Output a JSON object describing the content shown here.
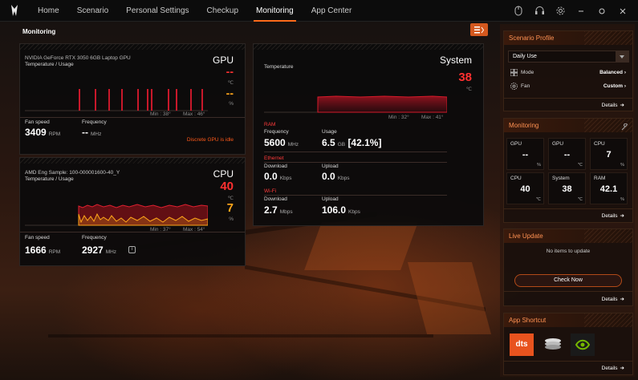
{
  "nav": {
    "tabs": [
      "Home",
      "Scenario",
      "Personal Settings",
      "Checkup",
      "Monitoring",
      "App Center"
    ],
    "active_index": 4
  },
  "icons": {
    "logo": "predator-logo-icon",
    "mouse": "mouse-icon",
    "headset": "headset-icon",
    "settings": "gear-icon",
    "minimize": "minimize-icon",
    "maximize": "restore-icon",
    "close": "close-icon"
  },
  "page": {
    "title": "Monitoring"
  },
  "gpu": {
    "name": "NVIDIA GeForce RTX 3050 6GB Laptop GPU",
    "subtitle": "Temperature / Usage",
    "title": "GPU",
    "temp_value": "--",
    "temp_unit": "℃",
    "usage_value": "--",
    "usage_unit": "%",
    "min": "Min : 38°",
    "max": "Max : 46°",
    "fan_label": "Fan speed",
    "fan_value": "3409",
    "fan_unit": "RPM",
    "freq_label": "Frequency",
    "freq_value": "--",
    "freq_unit": "MHz",
    "status": "Discrete GPU is idle"
  },
  "cpu": {
    "name": "AMD Eng Sample: 100-000001600-40_Y",
    "subtitle": "Temperature / Usage",
    "title": "CPU",
    "temp_value": "40",
    "temp_unit": "℃",
    "usage_value": "7",
    "usage_unit": "%",
    "min": "Min : 37°",
    "max": "Max : 54°",
    "fan_label": "Fan speed",
    "fan_value": "1666",
    "fan_unit": "RPM",
    "freq_label": "Frequency",
    "freq_value": "2927",
    "freq_unit": "MHz"
  },
  "system": {
    "title": "System",
    "temp_label": "Temperature",
    "temp_value": "38",
    "temp_unit": "℃",
    "min": "Min : 32°",
    "max": "Max : 41°",
    "ram": {
      "heading": "RAM",
      "freq_label": "Frequency",
      "freq_value": "5600",
      "freq_unit": "MHz",
      "usage_label": "Usage",
      "usage_value": "6.5",
      "usage_unit": "GB",
      "usage_pct": "[42.1%]"
    },
    "ethernet": {
      "heading": "Ethernet",
      "down_label": "Download",
      "down_value": "0.0",
      "down_unit": "Kbps",
      "up_label": "Upload",
      "up_value": "0.0",
      "up_unit": "Kbps"
    },
    "wifi": {
      "heading": "Wi-Fi",
      "down_label": "Download",
      "down_value": "2.7",
      "down_unit": "Mbps",
      "up_label": "Upload",
      "up_value": "106.0",
      "up_unit": "Kbps"
    }
  },
  "sidebar": {
    "scenario": {
      "title": "Scenario Profile",
      "profile": "Daily Use",
      "mode_label": "Mode",
      "mode_value": "Balanced",
      "fan_label": "Fan",
      "fan_value": "Custom",
      "details": "Details"
    },
    "monitoring": {
      "title": "Monitoring",
      "tiles": [
        {
          "label": "GPU",
          "value": "--",
          "unit": "%"
        },
        {
          "label": "GPU",
          "value": "--",
          "unit": "℃"
        },
        {
          "label": "CPU",
          "value": "7",
          "unit": "%"
        },
        {
          "label": "CPU",
          "value": "40",
          "unit": "℃"
        },
        {
          "label": "System",
          "value": "38",
          "unit": "℃"
        },
        {
          "label": "RAM",
          "value": "42.1",
          "unit": "%"
        }
      ],
      "details": "Details"
    },
    "live_update": {
      "title": "Live Update",
      "message": "No items to update",
      "button": "Check Now",
      "details": "Details"
    },
    "app_shortcut": {
      "title": "App Shortcut",
      "apps": [
        "dts",
        "disk-app-icon",
        "nvidia-icon"
      ],
      "dts_label": "dts",
      "details": "Details"
    }
  },
  "colors": {
    "accent": "#ff6a1a",
    "temp_red": "#ff3030",
    "usage_orange": "#ffa61a"
  }
}
